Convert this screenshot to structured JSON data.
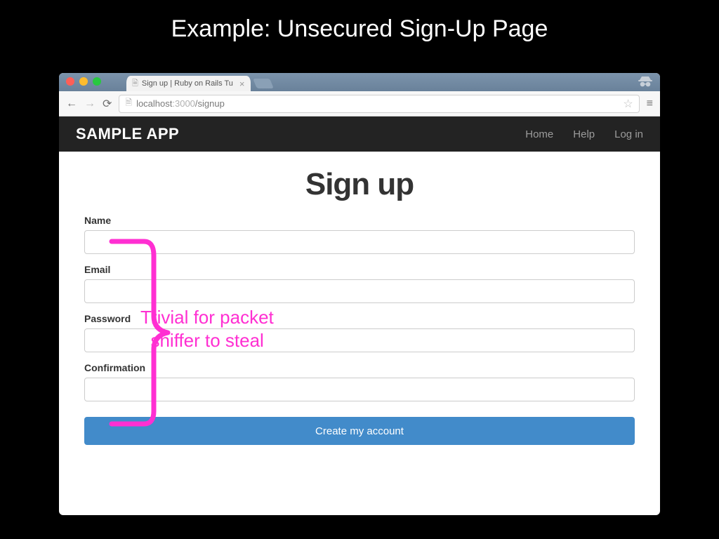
{
  "slide": {
    "title": "Example: Unsecured Sign-Up Page"
  },
  "browser": {
    "tab_title": "Sign up | Ruby on Rails Tu",
    "url_host": "localhost",
    "url_port": ":3000",
    "url_path": "/signup"
  },
  "appbar": {
    "brand": "SAMPLE APP",
    "links": {
      "home": "Home",
      "help": "Help",
      "login": "Log in"
    }
  },
  "page": {
    "heading": "Sign up",
    "labels": {
      "name": "Name",
      "email": "Email",
      "password": "Password",
      "confirmation": "Confirmation"
    },
    "submit": "Create my account"
  },
  "annotation": {
    "line1": "Trivial for packet",
    "line2": "sniffer to steal"
  },
  "colors": {
    "accent": "#428bca",
    "annotation": "#ff2fd2"
  }
}
